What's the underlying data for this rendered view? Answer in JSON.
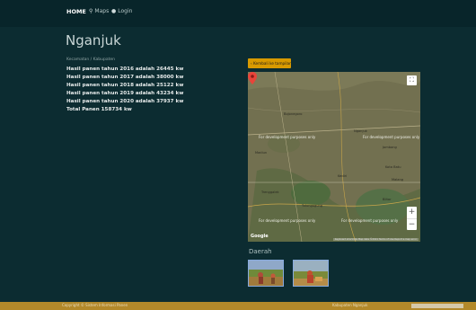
{
  "nav": {
    "home_label": "HOME",
    "maps_label": "Maps",
    "login_label": "Login",
    "icons": [
      "map-marker-icon",
      "user-icon"
    ]
  },
  "page": {
    "title": "Nganjuk",
    "subtitle": "Kecamatan / Kabupaten"
  },
  "harvest": {
    "lines": [
      "Hasil panen tahun 2016 adalah 26445 kw",
      "Hasil panen tahun 2017 adalah 38000 kw",
      "Hasil panen tahun 2018 adalah 25122 kw",
      "Hasil panen tahun 2019 adalah 43234 kw",
      "Hasil panen tahun 2020 adalah 37937 kw",
      "Total Panen 158734 kw"
    ]
  },
  "back_button": {
    "label": "‹ Kembali ke tampilan"
  },
  "map": {
    "dev_watermark": "For development purposes only",
    "logo": "Google",
    "footer_text": "Keyboard shortcuts   Map data ©2021   Terms of Use   Report a map error",
    "labels": [
      "Bojonegoro",
      "Nganjuk",
      "Kediri",
      "Madiun",
      "Jombang",
      "Blitar",
      "Tulungagung",
      "Malang",
      "Kota Batu",
      "Trenggalek"
    ],
    "fullscreen_icon": "fullscreen-icon",
    "zoom_in": "+",
    "zoom_out": "−"
  },
  "gallery": {
    "title": "Daerah"
  },
  "footer": {
    "left_text": "Copyright © Sistem Informasi Panen",
    "right_text": "Kabupaten Nganjuk"
  },
  "colors": {
    "background": "#0c2c31",
    "navbar": "#08252a",
    "accent": "#d89a00",
    "footer": "#b3892a"
  }
}
